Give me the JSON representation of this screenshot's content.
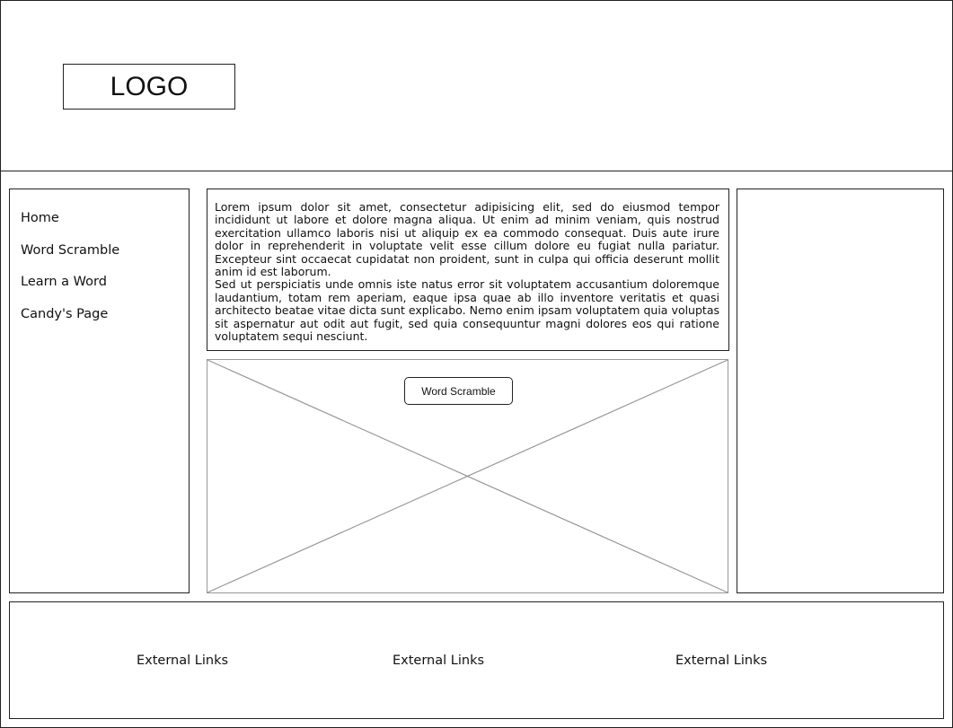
{
  "header": {
    "logo_text": "LOGO"
  },
  "sidebar": {
    "items": [
      {
        "label": "Home"
      },
      {
        "label": "Word Scramble"
      },
      {
        "label": "Learn a Word"
      },
      {
        "label": "Candy's Page"
      }
    ]
  },
  "main": {
    "paragraphs": [
      "Lorem ipsum dolor sit amet, consectetur adipisicing elit, sed do eiusmod tempor incididunt ut labore et dolore magna aliqua. Ut enim ad minim veniam, quis nostrud exercitation ullamco laboris nisi ut aliquip ex ea commodo consequat. Duis aute irure dolor in reprehenderit in voluptate velit esse cillum dolore eu fugiat nulla pariatur. Excepteur sint occaecat cupidatat non proident, sunt in culpa qui officia deserunt mollit anim id est laborum.",
      "Sed ut perspiciatis unde omnis iste natus error sit voluptatem accusantium doloremque laudantium, totam rem aperiam, eaque ipsa quae ab illo inventore veritatis et quasi architecto beatae vitae dicta sunt explicabo. Nemo enim ipsam voluptatem quia voluptas sit aspernatur aut odit aut fugit, sed quia consequuntur magni dolores eos qui ratione voluptatem sequi nesciunt."
    ],
    "image_button_label": "Word Scramble"
  },
  "footer": {
    "links": [
      {
        "label": "External Links"
      },
      {
        "label": "External Links"
      },
      {
        "label": "External Links"
      }
    ]
  }
}
